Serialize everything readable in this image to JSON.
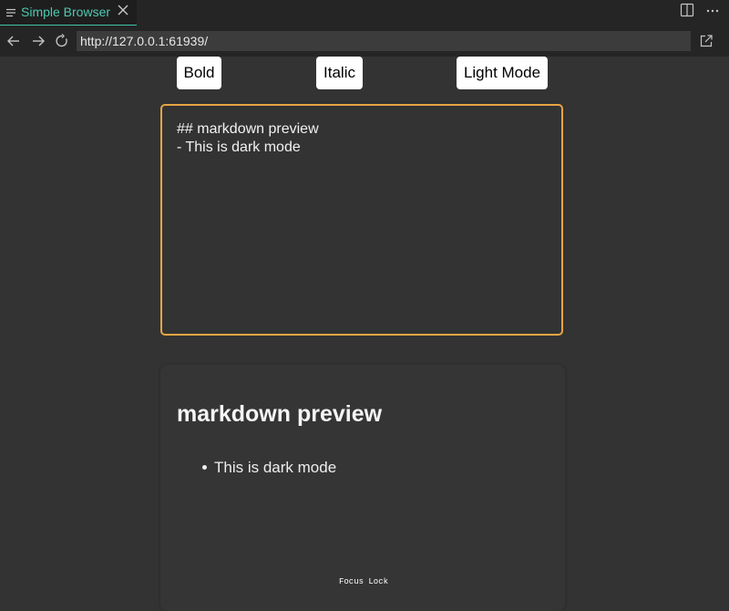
{
  "tab": {
    "title": "Simple Browser",
    "icon": "list-icon",
    "accent_color": "#4ec9b0"
  },
  "toolbar_right": {
    "split_icon": "split-editor-icon",
    "more_label": "···"
  },
  "nav": {
    "url": "http://127.0.0.1:61939/",
    "back_icon": "arrow-left-icon",
    "forward_icon": "arrow-right-icon",
    "reload_icon": "reload-icon",
    "open_external_icon": "open-external-icon"
  },
  "page": {
    "buttons": {
      "bold": "Bold",
      "italic": "Italic",
      "mode": "Light Mode"
    },
    "editor": {
      "lines": [
        "## markdown preview",
        "- This is dark mode"
      ],
      "border_color": "#e7a542"
    },
    "preview": {
      "heading": "markdown preview",
      "items": [
        "This is dark mode"
      ]
    },
    "focus_lock": "Focus Lock"
  }
}
